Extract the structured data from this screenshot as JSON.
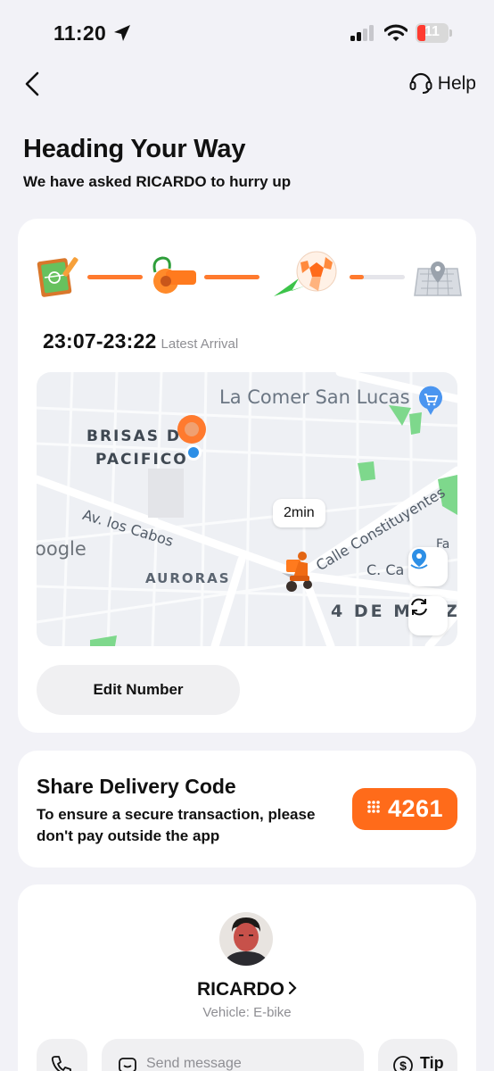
{
  "status_bar": {
    "time": "11:20",
    "battery": "11"
  },
  "nav": {
    "help_label": "Help"
  },
  "header": {
    "title": "Heading Your Way",
    "subtitle": "We have asked RICARDO to hurry up"
  },
  "progress": {
    "steps": [
      "order-board-icon",
      "whistle-icon",
      "soccer-ball-icon",
      "goal-location-icon"
    ],
    "current_step_fraction": 0.25
  },
  "eta": {
    "range": "23:07-23:22",
    "label": "Latest Arrival"
  },
  "map": {
    "eta_bubble": "2min",
    "labels": {
      "store": "La Comer San Lucas",
      "area1_line1": "BRISAS D",
      "area1_line2": "PACIFICO",
      "street1": "Av. los Cabos",
      "street2": "Calle Constituyentes",
      "street3": "C. Ca",
      "street3b": "Fa",
      "area2": "AURORAS",
      "area3": "4 DE M",
      "area3b": "Z",
      "google": "oogle"
    }
  },
  "edit_number_label": "Edit Number",
  "delivery_code": {
    "title": "Share Delivery Code",
    "description": "To ensure a secure transaction, please don't pay outside the app",
    "code": "4261"
  },
  "courier": {
    "name": "RICARDO",
    "vehicle": "Vehicle: E-bike",
    "message_placeholder": "Send message",
    "tip_label": "Tip"
  },
  "colors": {
    "accent": "#ff6b1a",
    "background": "#f2f2f7",
    "battery_low": "#ff3b30"
  }
}
